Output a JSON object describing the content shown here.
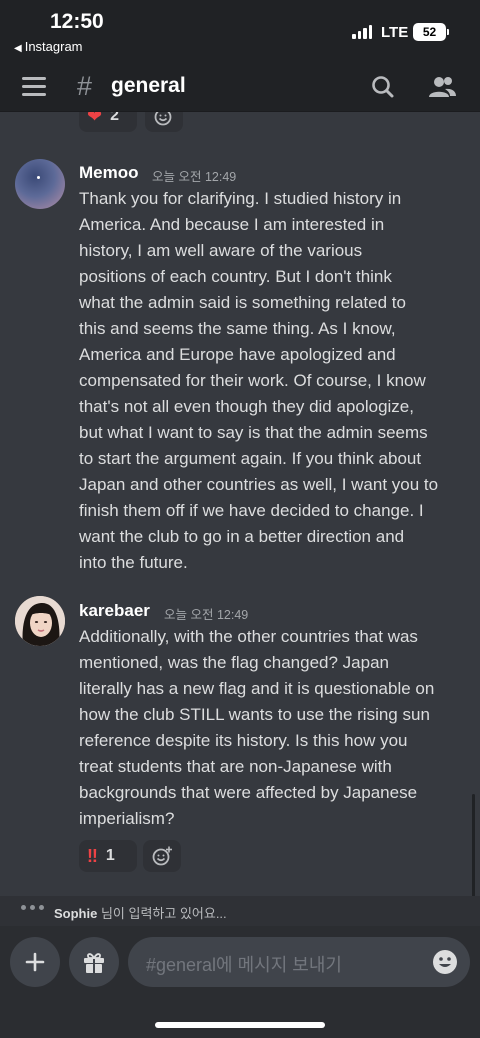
{
  "status_bar": {
    "time": "12:50",
    "back_app": "Instagram",
    "network": "LTE",
    "battery": "52"
  },
  "header": {
    "hash": "#",
    "channel": "general",
    "icons": [
      "menu-icon",
      "search-icon",
      "members-icon"
    ]
  },
  "top_reaction": {
    "emoji": "❤",
    "count": "2"
  },
  "messages": [
    {
      "author": "Memoo",
      "timestamp": "오늘 오전 12:49",
      "lines": [
        "Thank you for clarifying. I studied history in",
        "America. And because I am interested in",
        "history, I am well aware of the various",
        "positions of each country. But I don't think",
        "what the admin said is something related to",
        "this and seems the same thing. As I know,",
        "America and Europe have apologized and",
        "compensated for their work. Of course, I know",
        "that's not all even though they did apologize,",
        "but what I want to say is that the admin seems",
        "to start the argument again. If you think about",
        "Japan and other countries as well, I want you to",
        "finish them off if we have decided to change. I",
        "want the club to go in a better direction and",
        "into the future."
      ]
    },
    {
      "author": "karebaer",
      "timestamp": "오늘 오전 12:49",
      "lines": [
        "Additionally, with the other countries that was",
        "mentioned, was the flag changed? Japan",
        "literally has a new flag and it is questionable on",
        "how the club STILL wants to use the rising sun",
        "reference despite its history. Is this how you",
        "treat students that are non-Japanese with",
        "backgrounds that were affected by Japanese",
        "imperialism?"
      ],
      "reaction": {
        "emoji": "‼",
        "count": "1"
      }
    }
  ],
  "typing": {
    "user": "Sophie",
    "text": " 님이 입력하고 있어요..."
  },
  "composer": {
    "placeholder": "#general에 메시지 보내기"
  },
  "colors": {
    "background": "#36393f",
    "header": "#202225",
    "accent_red": "#ed4245"
  }
}
